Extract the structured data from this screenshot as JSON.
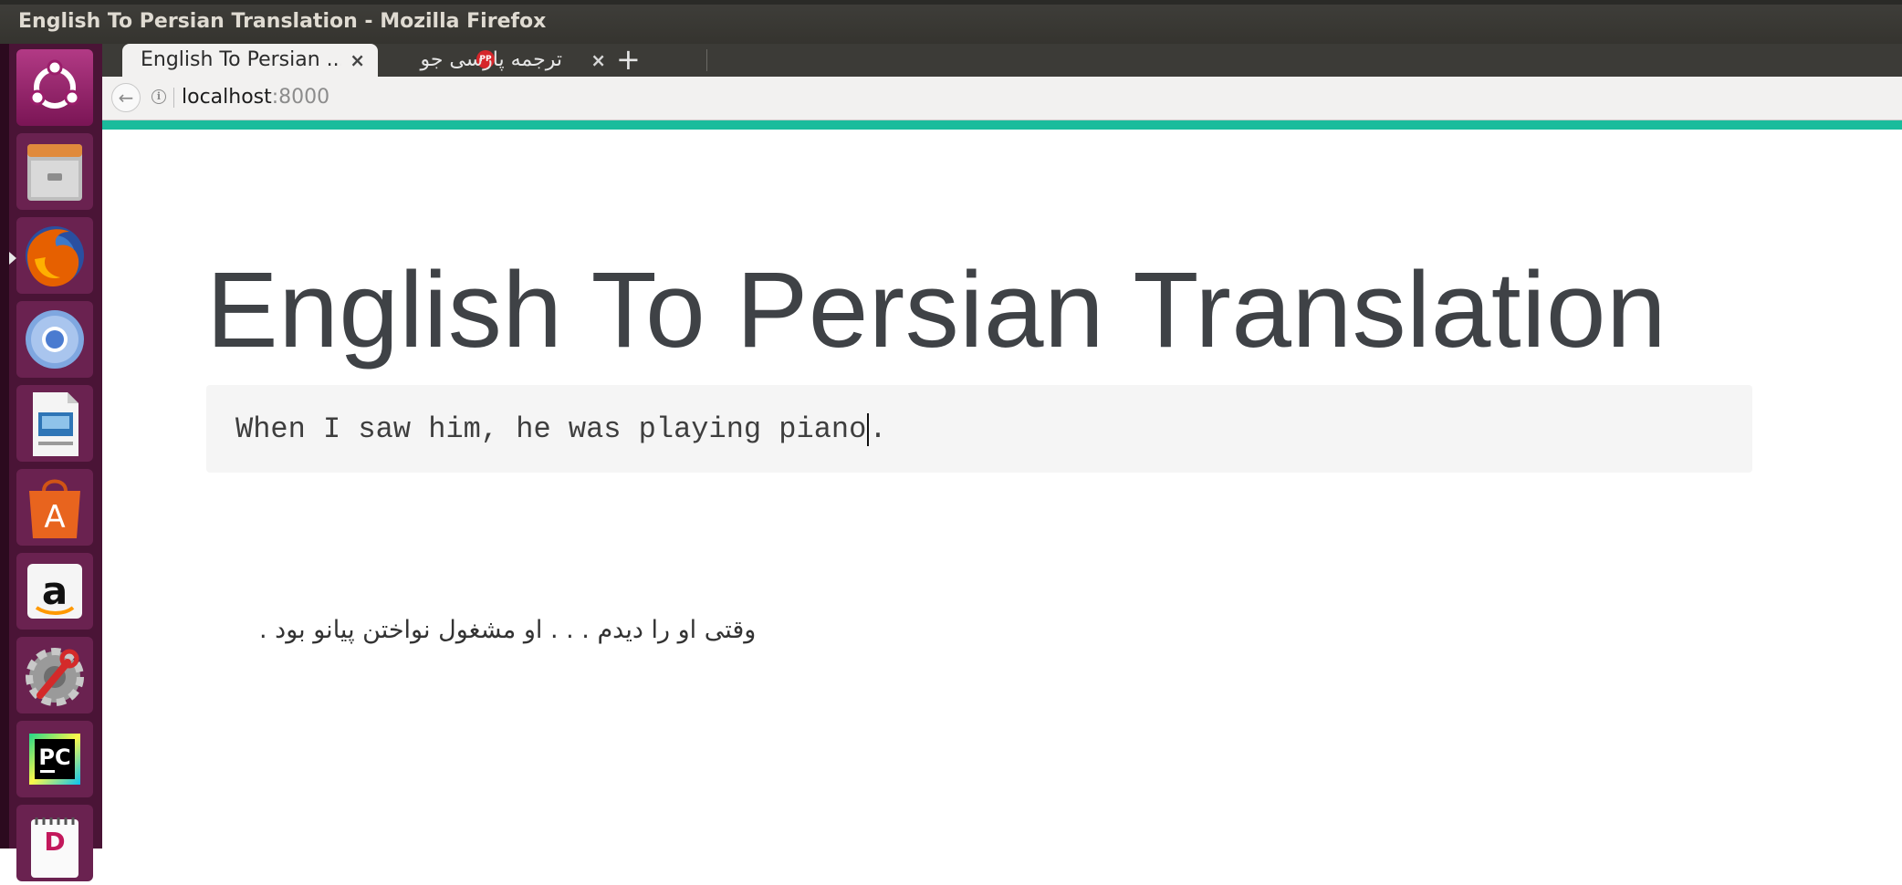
{
  "window": {
    "title": "English To Persian Translation - Mozilla Firefox"
  },
  "launcher": {
    "items": [
      {
        "name": "ubuntu-dash-icon",
        "color": "#9b1d6b"
      },
      {
        "name": "files-icon",
        "color": "#8d8d8d"
      },
      {
        "name": "firefox-icon",
        "color": "#e66000",
        "active": true
      },
      {
        "name": "chromium-icon",
        "color": "#4a7bd0"
      },
      {
        "name": "libreoffice-impress-icon",
        "color": "#2e75b6"
      },
      {
        "name": "software-center-icon",
        "color": "#e8641e"
      },
      {
        "name": "amazon-icon",
        "color": "#f5f5f5"
      },
      {
        "name": "system-settings-icon",
        "color": "#9a9a9a"
      },
      {
        "name": "pycharm-icon",
        "color": "#1c1c1c"
      },
      {
        "name": "notepad-icon",
        "color": "#ffffff"
      }
    ],
    "pycharm_text": "PC",
    "amazon_text": "a",
    "software_text": "A"
  },
  "tabs": [
    {
      "label": "English To Persian ...",
      "active": true
    },
    {
      "label": "ترجمه پارسی جو",
      "active": false,
      "favicon_text": "PP"
    }
  ],
  "tab_close_glyph": "×",
  "new_tab_glyph": "+",
  "navbar": {
    "url_host": "localhost",
    "url_port": ":8000"
  },
  "page": {
    "heading": "English To Persian Translation",
    "input_before_caret": "When I saw him, he was playing piano",
    "input_after_caret": ".",
    "translation": "وقتی او را دیدم . . . او مشغول نواختن پیانو بود ."
  },
  "colors": {
    "accent_bar": "#1abc9c",
    "launcher_bg": "#4a1436",
    "heading_text": "#3f4246"
  }
}
